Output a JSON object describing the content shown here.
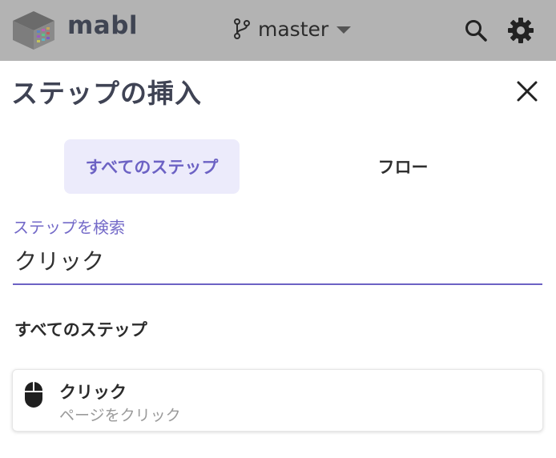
{
  "header": {
    "brand": "mabl",
    "branch": "master",
    "icons": [
      "mabl-logo-icon",
      "branch-icon",
      "chevron-down-icon",
      "search-icon",
      "gear-icon"
    ]
  },
  "dialog": {
    "title": "ステップの挿入",
    "close_icon": "close-icon",
    "tabs": [
      {
        "label": "すべてのステップ",
        "selected": true
      },
      {
        "label": "フロー",
        "selected": false
      }
    ],
    "search": {
      "label": "ステップを検索",
      "value": "クリック"
    },
    "section_title": "すべてのステップ",
    "results": [
      {
        "name": "クリック",
        "description": "ページをクリック",
        "icon": "mouse-icon"
      }
    ]
  },
  "colors": {
    "accent": "#6c62c4",
    "tab_selected_bg": "#ecebfb",
    "topbar_bg": "#b3b3b3",
    "title_text": "#3f4354"
  }
}
